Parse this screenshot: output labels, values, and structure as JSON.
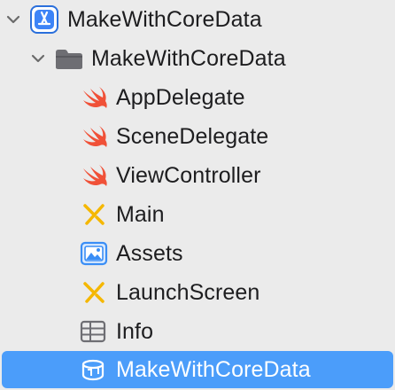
{
  "navigator": {
    "items": [
      {
        "label": "MakeWithCoreData",
        "icon": "xcode-project-icon",
        "expanded": true,
        "depth": 0
      },
      {
        "label": "MakeWithCoreData",
        "icon": "folder-icon",
        "expanded": true,
        "depth": 1
      },
      {
        "label": "AppDelegate",
        "icon": "swift-file-icon",
        "depth": 2
      },
      {
        "label": "SceneDelegate",
        "icon": "swift-file-icon",
        "depth": 2
      },
      {
        "label": "ViewController",
        "icon": "swift-file-icon",
        "depth": 2
      },
      {
        "label": "Main",
        "icon": "storyboard-icon",
        "depth": 2
      },
      {
        "label": "Assets",
        "icon": "asset-catalog-icon",
        "depth": 2
      },
      {
        "label": "LaunchScreen",
        "icon": "storyboard-icon",
        "depth": 2
      },
      {
        "label": "Info",
        "icon": "plist-icon",
        "depth": 2
      },
      {
        "label": "MakeWithCoreData",
        "icon": "core-data-model-icon",
        "depth": 2,
        "selected": true
      }
    ]
  },
  "colors": {
    "background": "#ebebeb",
    "selection": "#4b9dfa",
    "swift": "#f05138",
    "storyboard": "#f5b700",
    "asset_blue": "#3a8ef6",
    "folder_gray": "#6e6e73",
    "text": "#1d1d1f"
  }
}
